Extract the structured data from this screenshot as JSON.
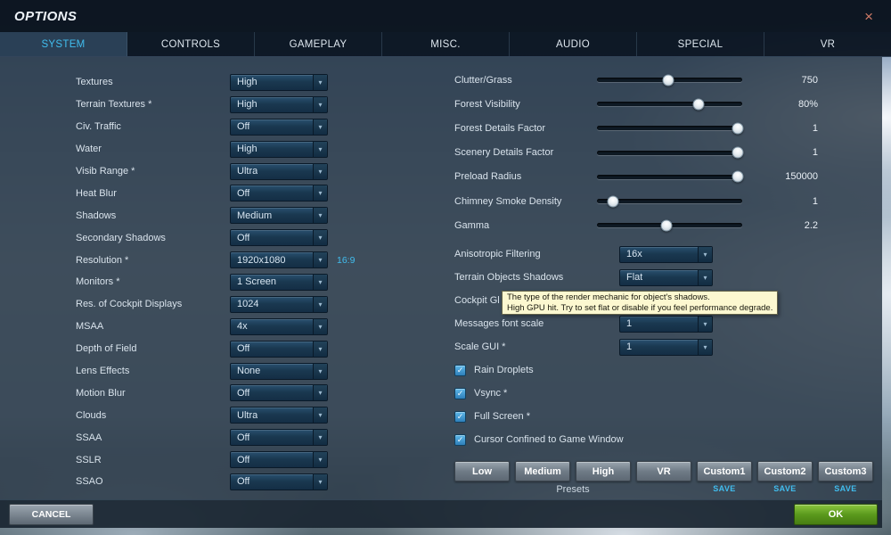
{
  "window": {
    "title": "OPTIONS",
    "close_glyph": "×"
  },
  "icons": {
    "dropdown_arrow": "▾",
    "checkbox_check": "✓"
  },
  "tabs": [
    {
      "label": "SYSTEM",
      "active": true
    },
    {
      "label": "CONTROLS",
      "active": false
    },
    {
      "label": "GAMEPLAY",
      "active": false
    },
    {
      "label": "MISC.",
      "active": false
    },
    {
      "label": "AUDIO",
      "active": false
    },
    {
      "label": "SPECIAL",
      "active": false
    },
    {
      "label": "VR",
      "active": false
    }
  ],
  "left_options": [
    {
      "label": "Textures",
      "value": "High"
    },
    {
      "label": "Terrain Textures *",
      "value": "High"
    },
    {
      "label": "Civ. Traffic",
      "value": "Off"
    },
    {
      "label": "Water",
      "value": "High"
    },
    {
      "label": "Visib Range *",
      "value": "Ultra"
    },
    {
      "label": "Heat Blur",
      "value": "Off"
    },
    {
      "label": "Shadows",
      "value": "Medium"
    },
    {
      "label": "Secondary Shadows",
      "value": "Off"
    },
    {
      "label": "Resolution *",
      "value": "1920x1080",
      "note": "16:9"
    },
    {
      "label": "Monitors *",
      "value": "1 Screen"
    },
    {
      "label": "Res. of Cockpit Displays",
      "value": "1024"
    },
    {
      "label": "MSAA",
      "value": "4x"
    },
    {
      "label": "Depth of Field",
      "value": "Off"
    },
    {
      "label": "Lens Effects",
      "value": "None"
    },
    {
      "label": "Motion Blur",
      "value": "Off"
    },
    {
      "label": "Clouds",
      "value": "Ultra"
    },
    {
      "label": "SSAA",
      "value": "Off"
    },
    {
      "label": "SSLR",
      "value": "Off"
    },
    {
      "label": "SSAO",
      "value": "Off"
    }
  ],
  "sliders": [
    {
      "label": "Clutter/Grass",
      "value": "750",
      "pos": 0.49
    },
    {
      "label": "Forest Visibility",
      "value": "80%",
      "pos": 0.7
    },
    {
      "label": "Forest Details Factor",
      "value": "1",
      "pos": 0.97
    },
    {
      "label": "Scenery Details Factor",
      "value": "1",
      "pos": 0.97
    },
    {
      "label": "Preload Radius",
      "value": "150000",
      "pos": 0.97
    },
    {
      "label": "Chimney Smoke Density",
      "value": "1",
      "pos": 0.11
    },
    {
      "label": "Gamma",
      "value": "2.2",
      "pos": 0.48
    }
  ],
  "right_dropdowns": [
    {
      "label": "Anisotropic Filtering",
      "value": "16x",
      "has_dropdown": true
    },
    {
      "label": "Terrain Objects Shadows",
      "value": "Flat",
      "has_dropdown": true
    },
    {
      "label": "Cockpit Gl",
      "value": "",
      "has_dropdown": false
    },
    {
      "label": "Messages font scale",
      "value": "1",
      "has_dropdown": true
    },
    {
      "label": "Scale GUI *",
      "value": "1",
      "has_dropdown": true
    }
  ],
  "tooltip": {
    "line1": "The type of the render mechanic for object's shadows.",
    "line2": "High GPU hit. Try to set flat or disable if you feel performance degrade."
  },
  "checkboxes": [
    {
      "label": "Rain Droplets",
      "checked": true
    },
    {
      "label": "Vsync *",
      "checked": true
    },
    {
      "label": "Full Screen *",
      "checked": true
    },
    {
      "label": "Cursor Confined to Game Window",
      "checked": true
    }
  ],
  "presets": {
    "buttons": [
      "Low",
      "Medium",
      "High",
      "VR",
      "Custom1",
      "Custom2",
      "Custom3"
    ],
    "group_label": "Presets",
    "save_label": "SAVE"
  },
  "footer": {
    "cancel": "CANCEL",
    "ok": "OK"
  },
  "colors": {
    "accent_cyan": "#41bdee",
    "ok_green": "#5b9a1d",
    "tooltip_bg": "#fcf8d0"
  }
}
